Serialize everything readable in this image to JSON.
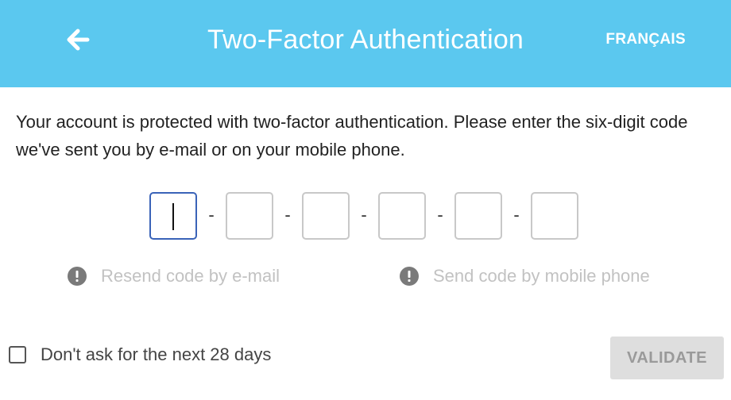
{
  "header": {
    "title": "Two-Factor Authentication",
    "language_link": "FRANÇAIS",
    "back_icon": "arrow-left-icon",
    "background_color": "#5bc8ef"
  },
  "main": {
    "intro_text": "Your account is protected with two-factor authentication. Please enter the six-digit code we've sent you by e-mail or on your mobile phone.",
    "code_digits": [
      "",
      "",
      "",
      "",
      "",
      ""
    ],
    "separator": "-",
    "resend_email": {
      "label": "Resend code by e-mail",
      "icon": "alert-circle-icon"
    },
    "send_phone": {
      "label": "Send code by mobile phone",
      "icon": "alert-circle-icon"
    }
  },
  "footer": {
    "remember_label": "Don't ask for the next 28 days",
    "remember_checked": false,
    "validate_label": "VALIDATE"
  },
  "colors": {
    "focus_border": "#3a63b8",
    "disabled_text": "#c2c2c2"
  }
}
